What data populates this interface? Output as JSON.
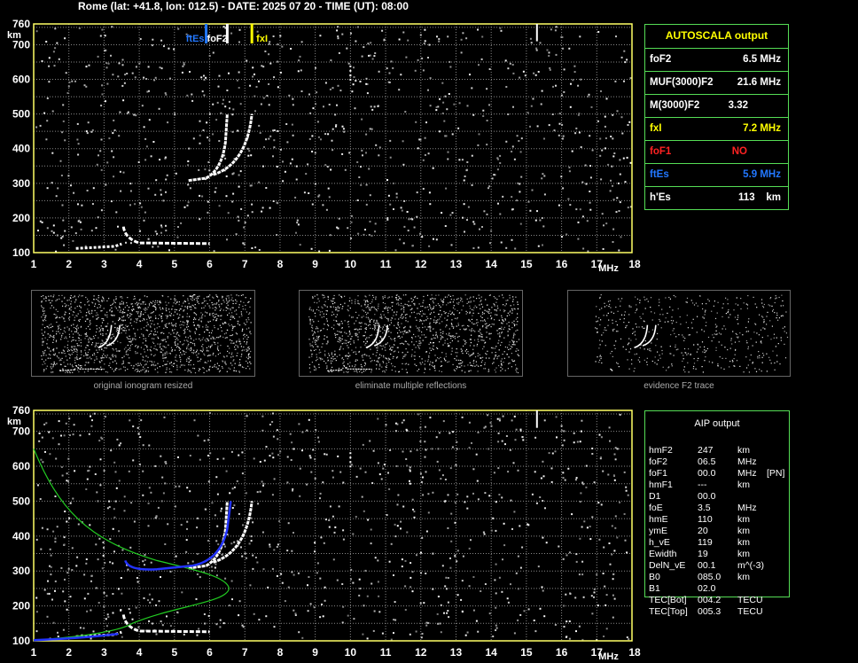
{
  "header": {
    "title": "Rome (lat: +41.8, lon: 012.5) - DATE: 2025 07 20 - TIME (UT): 08:00"
  },
  "colors": {
    "frame": "#ffff66",
    "grid": "#888888",
    "trace": "#ffffff",
    "ftEs": "#2277ff",
    "fxI": "#ffff00",
    "foF1": "#ff2222",
    "profile": "#22cc22",
    "aip_trace": "#2233ff",
    "table_border": "#55dd55"
  },
  "top_plot": {
    "y_unit": "km",
    "x_unit": "MHz",
    "y_ticks": [
      "760",
      "700",
      "600",
      "500",
      "400",
      "300",
      "200",
      "100"
    ],
    "x_ticks": [
      "1",
      "2",
      "3",
      "4",
      "5",
      "6",
      "7",
      "8",
      "9",
      "10",
      "11",
      "12",
      "13",
      "14",
      "15",
      "16",
      "17",
      "18"
    ],
    "markers": {
      "ftEs": "ftEs",
      "foF2": "foF2",
      "fxI": "fxI"
    },
    "marker_freqs": {
      "ftEs": 5.9,
      "foF2": 6.5,
      "fxI": 7.2
    },
    "es_height_km": 113
  },
  "autoscala": {
    "title": "AUTOSCALA output",
    "rows": [
      {
        "label": "foF2",
        "value": "6.5 MHz",
        "color": "#ffffff"
      },
      {
        "label": "MUF(3000)F2",
        "value": "21.6 MHz",
        "color": "#ffffff"
      },
      {
        "label": "M(3000)F2",
        "value": "3.32",
        "color": "#ffffff"
      },
      {
        "label": "fxI",
        "value": "7.2 MHz",
        "color": "#ffff00"
      },
      {
        "label": "foF1",
        "value": "NO",
        "color": "#ff2222"
      },
      {
        "label": "ftEs",
        "value": "5.9 MHz",
        "color": "#2277ff"
      },
      {
        "label": "h'Es",
        "value": "113    km",
        "color": "#ffffff"
      }
    ]
  },
  "thumbnails": [
    {
      "caption": "original ionogram resized"
    },
    {
      "caption": "eliminate multiple reflections"
    },
    {
      "caption": "evidence F2 trace"
    }
  ],
  "bottom_plot": {
    "y_unit": "km",
    "x_unit": "MHz",
    "y_ticks": [
      "760",
      "700",
      "600",
      "500",
      "400",
      "300",
      "200",
      "100"
    ],
    "x_ticks": [
      "1",
      "2",
      "3",
      "4",
      "5",
      "6",
      "7",
      "8",
      "9",
      "10",
      "11",
      "12",
      "13",
      "14",
      "15",
      "16",
      "17",
      "18"
    ]
  },
  "aip": {
    "title": "AIP output",
    "rows": [
      {
        "name": "hmF2",
        "value": "247",
        "unit": "km",
        "extra": ""
      },
      {
        "name": "foF2",
        "value": "06.5",
        "unit": "MHz",
        "extra": ""
      },
      {
        "name": "foF1",
        "value": "00.0",
        "unit": "MHz",
        "extra": "[PN]"
      },
      {
        "name": "hmF1",
        "value": "---",
        "unit": "km",
        "extra": ""
      },
      {
        "name": "D1",
        "value": "00.0",
        "unit": "",
        "extra": ""
      },
      {
        "name": "foE",
        "value": "3.5",
        "unit": "MHz",
        "extra": ""
      },
      {
        "name": "hmE",
        "value": "110",
        "unit": "km",
        "extra": ""
      },
      {
        "name": "ymE",
        "value": "20",
        "unit": "km",
        "extra": ""
      },
      {
        "name": "h_vE",
        "value": "119",
        "unit": "km",
        "extra": ""
      },
      {
        "name": "Ewidth",
        "value": "19",
        "unit": "km",
        "extra": ""
      },
      {
        "name": "DelN_vE",
        "value": "00.1",
        "unit": "m^(-3)",
        "extra": ""
      },
      {
        "name": "B0",
        "value": "085.0",
        "unit": "km",
        "extra": ""
      },
      {
        "name": "B1",
        "value": "02.0",
        "unit": "",
        "extra": ""
      },
      {
        "name": "TEC[Bot]",
        "value": "004.2",
        "unit": "TECU",
        "extra": ""
      },
      {
        "name": "TEC[Top]",
        "value": "005.3",
        "unit": "TECU",
        "extra": ""
      }
    ]
  }
}
